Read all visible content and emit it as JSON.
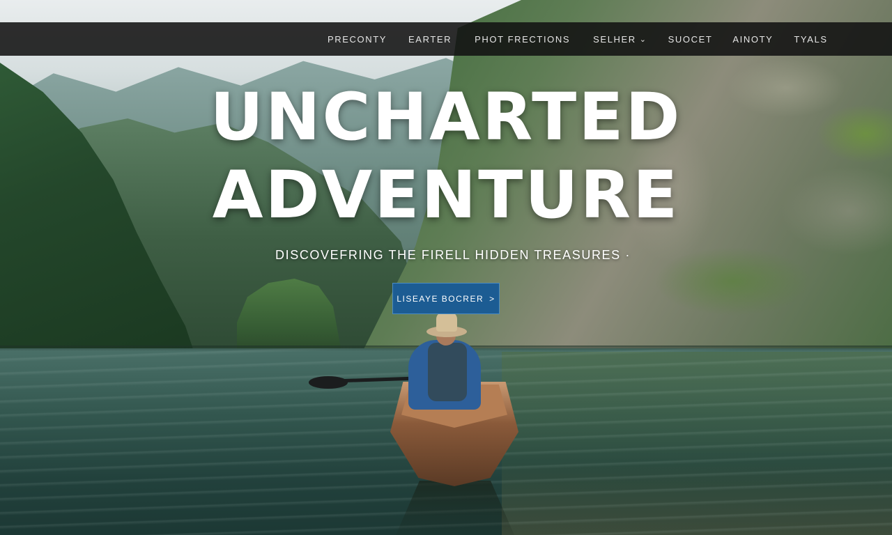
{
  "nav": {
    "items": [
      {
        "label": "PRECONTY"
      },
      {
        "label": "EARTER"
      },
      {
        "label": "PHOT FRECTIONS"
      },
      {
        "label": "SELHER",
        "chevron": "chevron-down-icon",
        "chevron_glyph": "⌄"
      },
      {
        "label": "SUOCET"
      },
      {
        "label": "AINOTY"
      },
      {
        "label": "TYALS"
      }
    ]
  },
  "hero": {
    "title_line1": "UNCHARTED",
    "title_line2": "ADVENTURE",
    "tagline": "DISCOVEFRING THE FIRELL HIDDEN TREASURES",
    "tagline_mark": "·",
    "cta_label": "LISEAYE BOCRER",
    "cta_arrow": ">"
  },
  "colors": {
    "nav_bg": "#121212",
    "cta_bg": "#1c5c93",
    "cta_border": "#4b8cc2",
    "title": "#ffffff"
  }
}
